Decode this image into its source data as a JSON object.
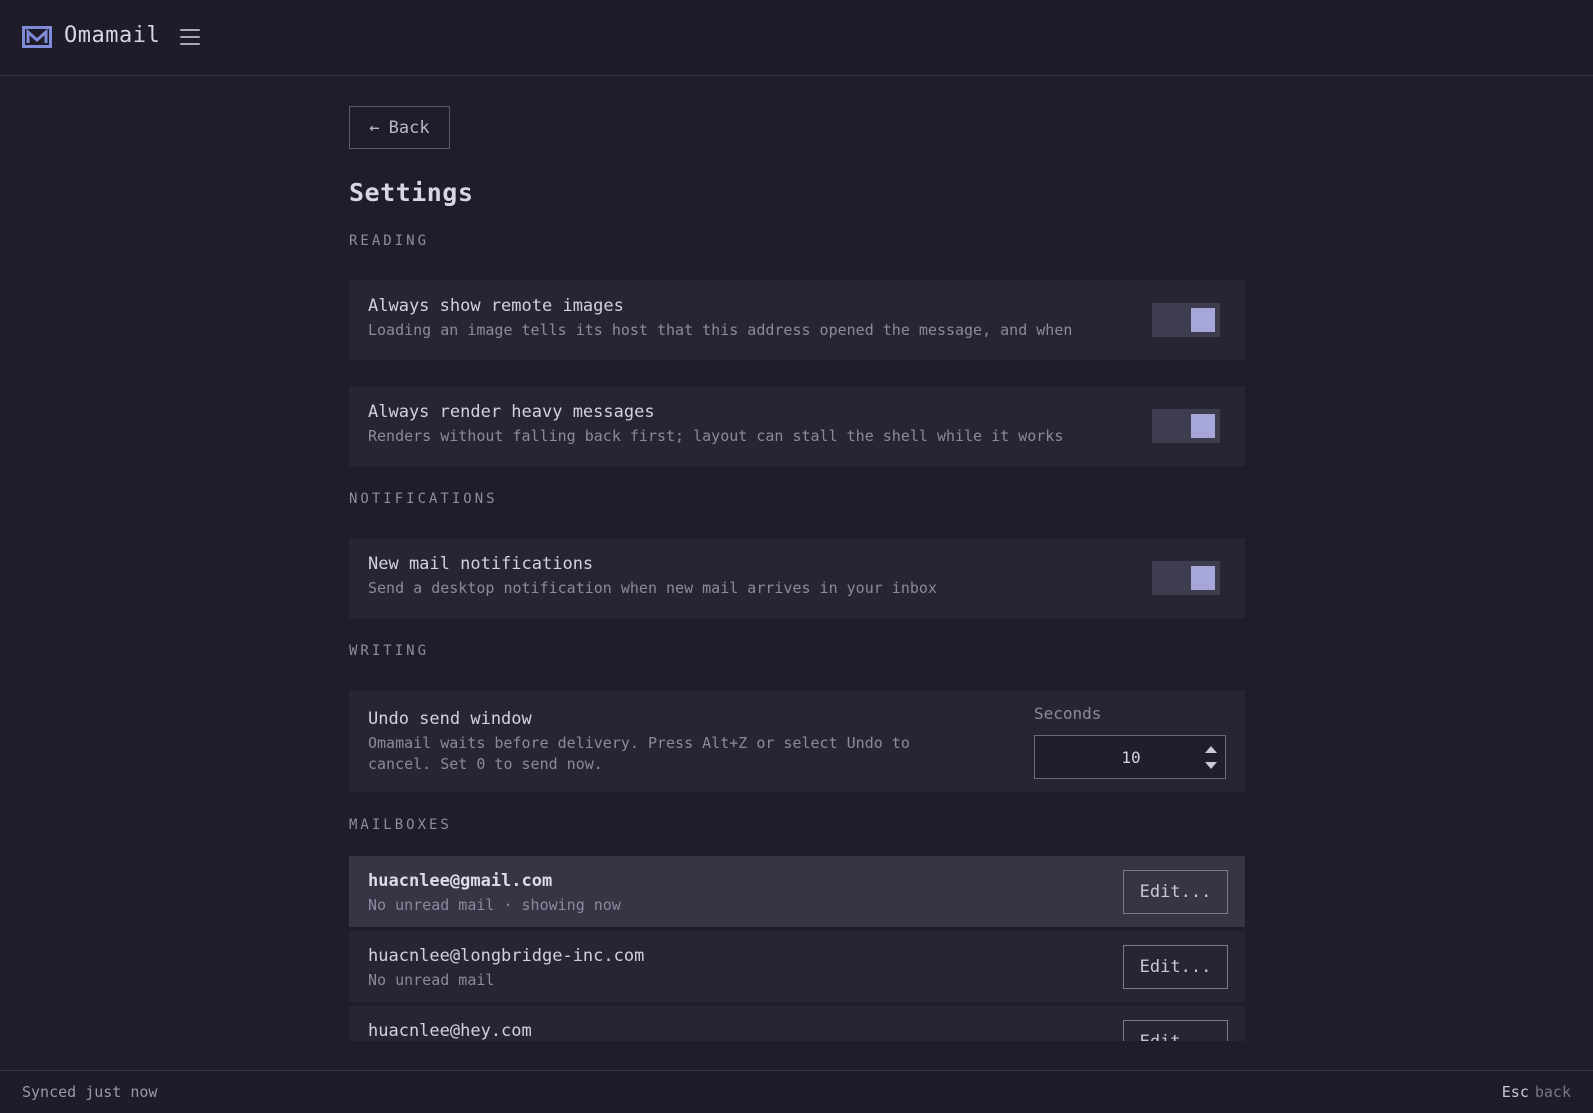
{
  "app": {
    "title": "Omamail"
  },
  "back": {
    "label": "Back"
  },
  "page": {
    "title": "Settings"
  },
  "sections": {
    "reading": "READING",
    "notifications": "NOTIFICATIONS",
    "writing": "WRITING",
    "mailboxes": "MAILBOXES"
  },
  "settings": {
    "remote_images": {
      "title": "Always show remote images",
      "desc": "Loading an image tells its host that this address opened the message, and when",
      "enabled": true
    },
    "heavy_messages": {
      "title": "Always render heavy messages",
      "desc": "Renders without falling back first; layout can stall the shell while it works",
      "enabled": true
    },
    "new_mail_notifications": {
      "title": "New mail notifications",
      "desc": "Send a desktop notification when new mail arrives in your inbox",
      "enabled": true
    },
    "undo_send": {
      "title": "Undo send window",
      "desc_line1": "Omamail waits before delivery. Press Alt+Z or select Undo to",
      "desc_line2": "cancel. Set 0 to send now.",
      "unit_label": "Seconds",
      "value": "10"
    }
  },
  "mailboxes": [
    {
      "email": "huacnlee@gmail.com",
      "status": "No unread mail · showing now",
      "edit_label": "Edit...",
      "active": true
    },
    {
      "email": "huacnlee@longbridge-inc.com",
      "status": "No unread mail",
      "edit_label": "Edit...",
      "active": false
    },
    {
      "email": "huacnlee@hey.com",
      "status": "",
      "edit_label": "Edit...",
      "active": false
    }
  ],
  "status": {
    "sync": "Synced just now",
    "esc_key": "Esc",
    "esc_label": "back"
  },
  "colors": {
    "background": "#1e1d29",
    "card": "#262534",
    "active_card": "#363546",
    "toggle_knob": "#a7a6d8",
    "logo": "#7f8ad8"
  }
}
